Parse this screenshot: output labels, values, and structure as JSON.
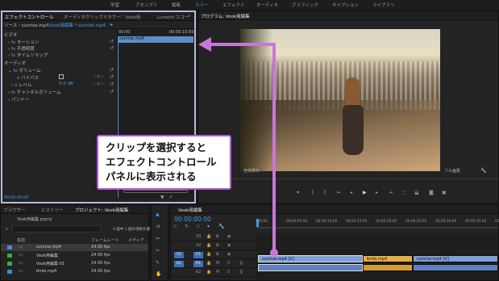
{
  "top_menu": [
    "学習",
    "アセンブリ",
    "編集",
    "カラー",
    "エフェクト",
    "オーディオ",
    "グラフィック",
    "キャプション",
    "ライブラリ"
  ],
  "effect_panel": {
    "tabs": [
      "エフェクトコントロール",
      "オーディオクリップミキサー：Vook用",
      "Lumetri スコー"
    ],
    "source_label": "ソース・sunrise.mp4",
    "sequence_label": "Vook用編集 * sunrise.mp4",
    "timecode_start": "00:00",
    "timecode_end": "00:00:15:00",
    "clip_name": "sunrise.mp4",
    "video_header": "ビデオ",
    "rows": [
      "モーション",
      "不透明度",
      "タイムリマップ"
    ],
    "audio_header": "オーディオ",
    "volume_label": "ボリューム",
    "bypass_label": "バイパス",
    "level_label": "レベル",
    "level_value": "0.0 dB",
    "channel_volume": "チャンネルボリューム",
    "panner": "パンナー",
    "bottom_timecode": "00:00:00:00"
  },
  "program": {
    "title": "プログラム: Vook用編集",
    "fit_label": "全体表示",
    "quality_label": "フル画質"
  },
  "project_panel": {
    "tabs": [
      "ブラウザー",
      "ヒストリー",
      "プロジェクト: Vook用編集"
    ],
    "project_file": "Vook用編集.prproj",
    "search_placeholder": "",
    "selection_info": "4 個中 1 個の項目が選",
    "columns": [
      "名前",
      "フレームレート",
      "メディア"
    ],
    "items": [
      {
        "name": "sunrise.mp4",
        "fps": "24.00 fps",
        "color": "#3b8ed8"
      },
      {
        "name": "Vook用編集",
        "fps": "24.00 fps",
        "color": "#3aa84c"
      },
      {
        "name": "Vook用編集-01",
        "fps": "24.00 fps",
        "color": "#3aa84c"
      },
      {
        "name": "birds.mp4",
        "fps": "24.00 fps",
        "color": "#3b8ed8"
      }
    ]
  },
  "timeline": {
    "tab": "Vook用編集",
    "timecode": "00:00:00:00",
    "ruler": [
      ":00:00",
      "00:00:05:00",
      "00:00:10:00",
      "00:00:15:00",
      "00:00:20:00",
      "00:00:25:00",
      "00:00:30:00",
      "00:00:35:00",
      "00:00:40:00"
    ],
    "tracks": [
      "V3",
      "V2",
      "V1",
      "A1",
      "A2"
    ],
    "source_patch": [
      "V1",
      "A1"
    ],
    "clips": {
      "v1_a": "sunrise.mp4 [V]",
      "v1_b": "birds.mp4",
      "v1_c": "sunrise.mp4 [V]"
    }
  },
  "callout": {
    "lines": [
      "クリップを選択すると",
      "エフェクトコントロール",
      "パネルに表示される"
    ],
    "color": "#c777d9"
  }
}
